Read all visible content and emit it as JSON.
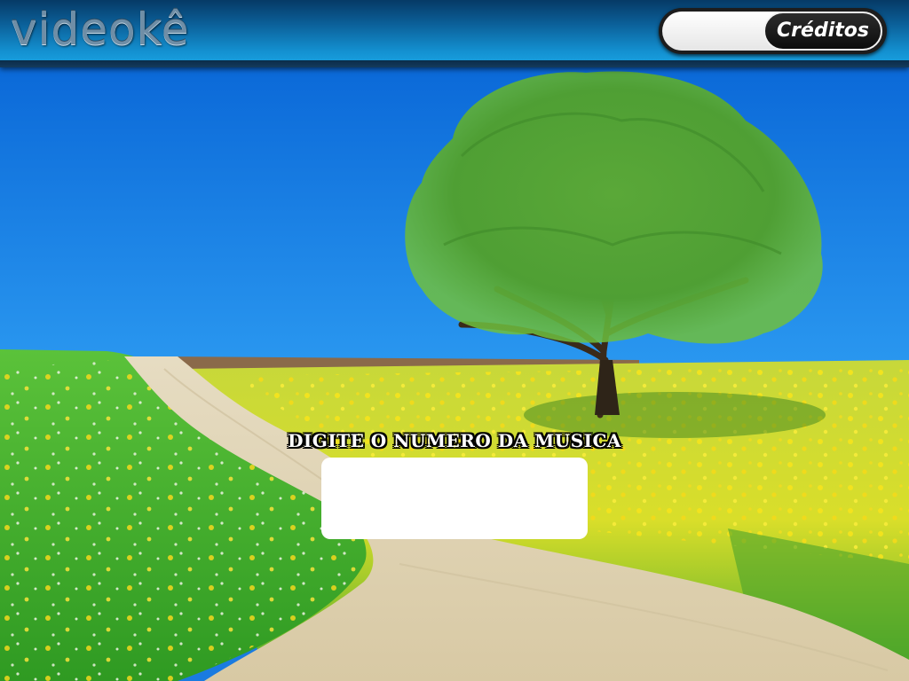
{
  "header": {
    "logo_text": "videokê",
    "credits_value": "",
    "credits_button_label": "Créditos"
  },
  "prompt": {
    "label": "DIGITE O NUMERO DA MUSICA",
    "input_value": "",
    "input_placeholder": ""
  },
  "colors": {
    "header_dark": "#063a66",
    "header_light": "#1aa6e6",
    "sky": "#1a7be0",
    "grass": "#3fae2a",
    "flowers": "#f2e020",
    "road": "#e8dcc0"
  },
  "icons": {
    "background": "landscape-tree-road"
  }
}
